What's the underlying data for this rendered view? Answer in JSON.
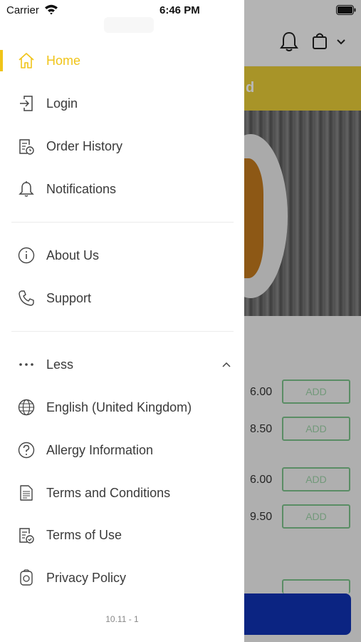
{
  "status_bar": {
    "carrier": "Carrier",
    "time": "6:46 PM"
  },
  "background": {
    "banner_text": "d",
    "prices": [
      "6.00",
      "8.50",
      "6.00",
      "9.50"
    ],
    "add_label": "ADD"
  },
  "drawer": {
    "primary_items": [
      {
        "label": "Home",
        "icon": "home-icon",
        "active": true
      },
      {
        "label": "Login",
        "icon": "login-icon"
      },
      {
        "label": "Order History",
        "icon": "order-history-icon"
      },
      {
        "label": "Notifications",
        "icon": "bell-icon"
      }
    ],
    "secondary_items": [
      {
        "label": "About Us",
        "icon": "info-icon"
      },
      {
        "label": "Support",
        "icon": "phone-icon"
      }
    ],
    "more_toggle": {
      "label": "Less",
      "icon": "more-dots-icon"
    },
    "extra_items": [
      {
        "label": "English (United Kingdom)",
        "icon": "globe-icon"
      },
      {
        "label": "Allergy Information",
        "icon": "question-icon"
      },
      {
        "label": "Terms and Conditions",
        "icon": "document-icon"
      },
      {
        "label": "Terms of Use",
        "icon": "document-check-icon"
      },
      {
        "label": "Privacy Policy",
        "icon": "privacy-icon"
      }
    ],
    "version": "10.11 - 1",
    "accent_color": "#f0c419"
  }
}
